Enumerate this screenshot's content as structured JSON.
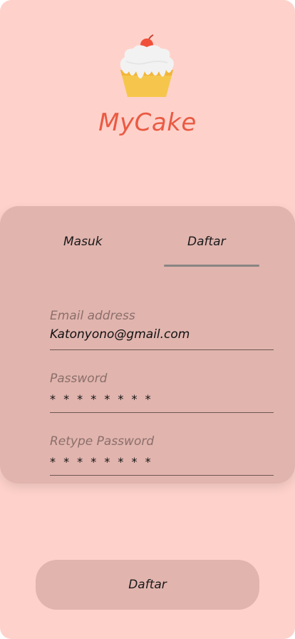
{
  "app": {
    "title": "MyCake"
  },
  "colors": {
    "background": "#fed2cb",
    "card": "#e1b4ae",
    "accent": "#ea5a43"
  },
  "tabs": [
    {
      "label": "Masuk",
      "selected": false
    },
    {
      "label": "Daftar",
      "selected": true
    }
  ],
  "form": {
    "email": {
      "label": "Email address",
      "value": "Katonyono@gmail.com"
    },
    "password": {
      "label": "Password",
      "value": "* * * * * * * *"
    },
    "retype_password": {
      "label": "Retype Password",
      "value": "* * * * * * * *"
    }
  },
  "submit_label": "Daftar",
  "icons": {
    "logo": "cupcake-icon"
  }
}
